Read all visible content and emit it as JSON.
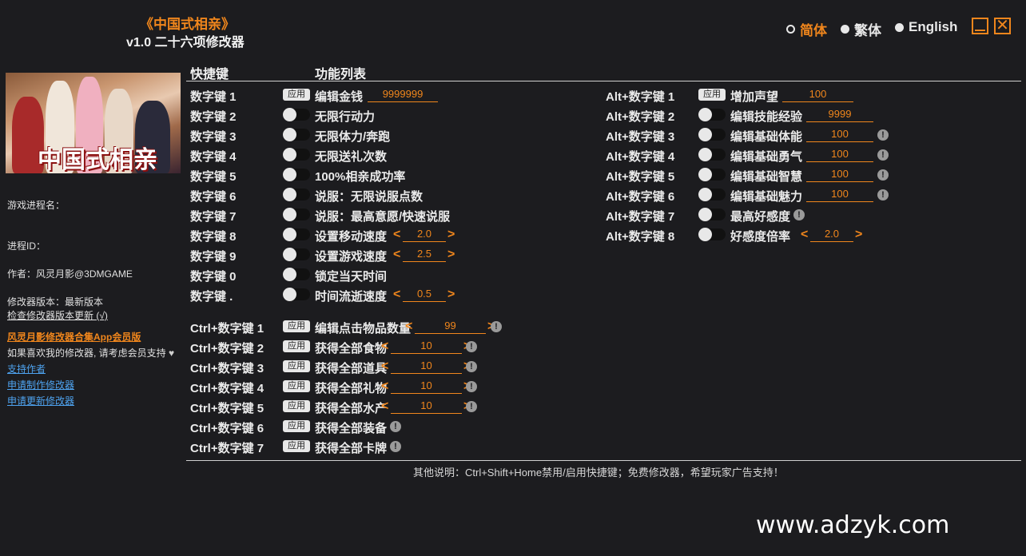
{
  "app": {
    "title": "《中国式相亲》",
    "subtitle": "v1.0 二十六项修改器"
  },
  "languages": [
    {
      "label": "简体",
      "selected": true
    },
    {
      "label": "繁体",
      "selected": false
    },
    {
      "label": "English",
      "selected": false
    }
  ],
  "window": {
    "minimize_icon": "minimize-icon",
    "close_icon": "close-icon",
    "close_glyph": "✕"
  },
  "cover": {
    "title": "中国式相亲"
  },
  "sidebar": {
    "process_name_label": "游戏进程名：",
    "process_id_label": "进程ID：",
    "author": "作者：风灵月影@3DMGAME",
    "version": "修改器版本：最新版本",
    "check_update": "检查修改器版本更新 (√)",
    "app_link": "风灵月影修改器合集App会员版",
    "support_text": "如果喜欢我的修改器, 请考虑会员支持",
    "heart": "♥",
    "support_author": "支持作者",
    "request_make": "申请制作修改器",
    "request_update": "申请更新修改器"
  },
  "headers": {
    "hotkey": "快捷键",
    "features": "功能列表"
  },
  "apply_label": "应用",
  "arrows": {
    "left": "<",
    "right": ">"
  },
  "info_glyph": "!",
  "left_rows": [
    {
      "key": "数字键 1",
      "control": "apply",
      "name": "编辑金钱",
      "value": "9999999"
    },
    {
      "key": "数字键 2",
      "control": "toggle",
      "name": "无限行动力"
    },
    {
      "key": "数字键 3",
      "control": "toggle",
      "name": "无限体力/奔跑"
    },
    {
      "key": "数字键 4",
      "control": "toggle",
      "name": "无限送礼次数"
    },
    {
      "key": "数字键 5",
      "control": "toggle",
      "name": "100%相亲成功率"
    },
    {
      "key": "数字键 6",
      "control": "toggle",
      "name": "说服：无限说服点数"
    },
    {
      "key": "数字键 7",
      "control": "toggle",
      "name": "说服：最高意愿/快速说服"
    },
    {
      "key": "数字键 8",
      "control": "toggle",
      "name": "设置移动速度",
      "value": "2.0"
    },
    {
      "key": "数字键 9",
      "control": "toggle",
      "name": "设置游戏速度",
      "value": "2.5"
    },
    {
      "key": "数字键 0",
      "control": "toggle",
      "name": "锁定当天时间"
    },
    {
      "key": "数字键 .",
      "control": "toggle",
      "name": "时间流逝速度",
      "value": "0.5"
    }
  ],
  "ctrl_rows": [
    {
      "key": "Ctrl+数字键 1",
      "name": "编辑点击物品数量",
      "value": "99"
    },
    {
      "key": "Ctrl+数字键 2",
      "name": "获得全部食物",
      "value": "10"
    },
    {
      "key": "Ctrl+数字键 3",
      "name": "获得全部道具",
      "value": "10"
    },
    {
      "key": "Ctrl+数字键 4",
      "name": "获得全部礼物",
      "value": "10"
    },
    {
      "key": "Ctrl+数字键 5",
      "name": "获得全部水产",
      "value": "10"
    },
    {
      "key": "Ctrl+数字键 6",
      "name": "获得全部装备"
    },
    {
      "key": "Ctrl+数字键 7",
      "name": "获得全部卡牌"
    }
  ],
  "alt_rows": [
    {
      "key": "Alt+数字键 1",
      "control": "apply",
      "name": "增加声望",
      "value": "100"
    },
    {
      "key": "Alt+数字键 2",
      "control": "toggle",
      "name": "编辑技能经验",
      "value": "9999"
    },
    {
      "key": "Alt+数字键 3",
      "control": "toggle",
      "name": "编辑基础体能",
      "value": "100"
    },
    {
      "key": "Alt+数字键 4",
      "control": "toggle",
      "name": "编辑基础勇气",
      "value": "100"
    },
    {
      "key": "Alt+数字键 5",
      "control": "toggle",
      "name": "编辑基础智慧",
      "value": "100"
    },
    {
      "key": "Alt+数字键 6",
      "control": "toggle",
      "name": "编辑基础魅力",
      "value": "100"
    },
    {
      "key": "Alt+数字键 7",
      "control": "toggle",
      "name": "最高好感度"
    },
    {
      "key": "Alt+数字键 8",
      "control": "toggle",
      "name": "好感度倍率",
      "value": "2.0"
    }
  ],
  "footer": "其他说明：Ctrl+Shift+Home禁用/启用快捷键；免费修改器，希望玩家广告支持！",
  "watermark": "www.adzyk.com",
  "colors": {
    "accent": "#f0861c",
    "background": "#1c1c1f",
    "link": "#4ea3f0"
  }
}
